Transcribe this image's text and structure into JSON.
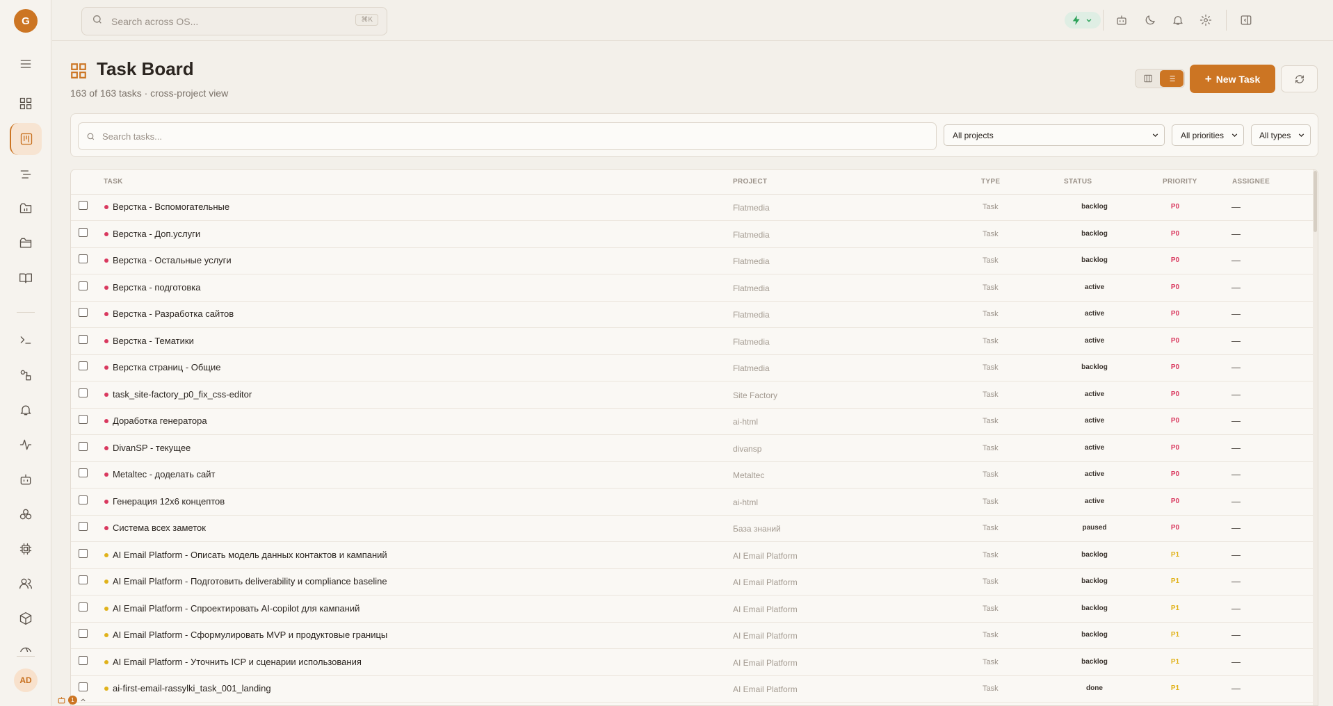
{
  "sidebar": {
    "logo_letter": "G",
    "avatar_initials": "AD",
    "icons": [
      "dashboard-icon",
      "task-board-icon",
      "roadmap-icon",
      "projects-icon",
      "folder-icon",
      "knowledge-book-icon",
      "terminal-icon",
      "workflow-icon",
      "notifications-bell-icon",
      "activity-icon",
      "bot-icon",
      "blocks-icon",
      "chip-icon",
      "users-icon",
      "package-icon",
      "globe-icon"
    ]
  },
  "topbar": {
    "search_placeholder": "Search across OS...",
    "search_shortcut": "⌘K"
  },
  "page": {
    "title": "Task Board",
    "subtitle": "163 of 163 tasks · cross-project view",
    "new_task_label": "New Task"
  },
  "filters": {
    "search_placeholder": "Search tasks...",
    "project_select": "All projects",
    "priority_select": "All priorities",
    "type_select": "All types"
  },
  "table": {
    "headers": {
      "task": "TASK",
      "project": "PROJECT",
      "type": "TYPE",
      "status": "STATUS",
      "priority": "PRIORITY",
      "assignee": "ASSIGNEE"
    },
    "rows": [
      {
        "task": "Верстка - Вспомогательные",
        "project": "Flatmedia",
        "type": "Task",
        "status": "backlog",
        "priority": "P0",
        "assignee": "—"
      },
      {
        "task": "Верстка - Доп.услуги",
        "project": "Flatmedia",
        "type": "Task",
        "status": "backlog",
        "priority": "P0",
        "assignee": "—"
      },
      {
        "task": "Верстка - Остальные услуги",
        "project": "Flatmedia",
        "type": "Task",
        "status": "backlog",
        "priority": "P0",
        "assignee": "—"
      },
      {
        "task": "Верстка - подготовка",
        "project": "Flatmedia",
        "type": "Task",
        "status": "active",
        "priority": "P0",
        "assignee": "—"
      },
      {
        "task": "Верстка - Разработка сайтов",
        "project": "Flatmedia",
        "type": "Task",
        "status": "active",
        "priority": "P0",
        "assignee": "—"
      },
      {
        "task": "Верстка - Тематики",
        "project": "Flatmedia",
        "type": "Task",
        "status": "active",
        "priority": "P0",
        "assignee": "—"
      },
      {
        "task": "Верстка страниц - Общие",
        "project": "Flatmedia",
        "type": "Task",
        "status": "backlog",
        "priority": "P0",
        "assignee": "—"
      },
      {
        "task": "task_site-factory_p0_fix_css-editor",
        "project": "Site Factory",
        "type": "Task",
        "status": "active",
        "priority": "P0",
        "assignee": "—"
      },
      {
        "task": "Доработка генератора",
        "project": "ai-html",
        "type": "Task",
        "status": "active",
        "priority": "P0",
        "assignee": "—"
      },
      {
        "task": "DivanSP - текущее",
        "project": "divansp",
        "type": "Task",
        "status": "active",
        "priority": "P0",
        "assignee": "—"
      },
      {
        "task": "Metaltec - доделать сайт",
        "project": "Metaltec",
        "type": "Task",
        "status": "active",
        "priority": "P0",
        "assignee": "—"
      },
      {
        "task": "Генерация 12x6 концептов",
        "project": "ai-html",
        "type": "Task",
        "status": "active",
        "priority": "P0",
        "assignee": "—"
      },
      {
        "task": "Система всех заметок",
        "project": "База знаний",
        "type": "Task",
        "status": "paused",
        "priority": "P0",
        "assignee": "—"
      },
      {
        "task": "AI Email Platform - Описать модель данных контактов и кампаний",
        "project": "AI Email Platform",
        "type": "Task",
        "status": "backlog",
        "priority": "P1",
        "assignee": "—"
      },
      {
        "task": "AI Email Platform - Подготовить deliverability и compliance baseline",
        "project": "AI Email Platform",
        "type": "Task",
        "status": "backlog",
        "priority": "P1",
        "assignee": "—"
      },
      {
        "task": "AI Email Platform - Спроектировать AI-copilot для кампаний",
        "project": "AI Email Platform",
        "type": "Task",
        "status": "backlog",
        "priority": "P1",
        "assignee": "—"
      },
      {
        "task": "AI Email Platform - Сформулировать MVP и продуктовые границы",
        "project": "AI Email Platform",
        "type": "Task",
        "status": "backlog",
        "priority": "P1",
        "assignee": "—"
      },
      {
        "task": "AI Email Platform - Уточнить ICP и сценарии использования",
        "project": "AI Email Platform",
        "type": "Task",
        "status": "backlog",
        "priority": "P1",
        "assignee": "—"
      },
      {
        "task": "ai-first-email-rassylki_task_001_landing",
        "project": "AI Email Platform",
        "type": "Task",
        "status": "done",
        "priority": "P1",
        "assignee": "—"
      }
    ]
  },
  "colors": {
    "accent": "#cc7523",
    "p0": "#d9385e",
    "p1": "#e0b21a"
  },
  "bottom_widget": {
    "count": "1"
  }
}
